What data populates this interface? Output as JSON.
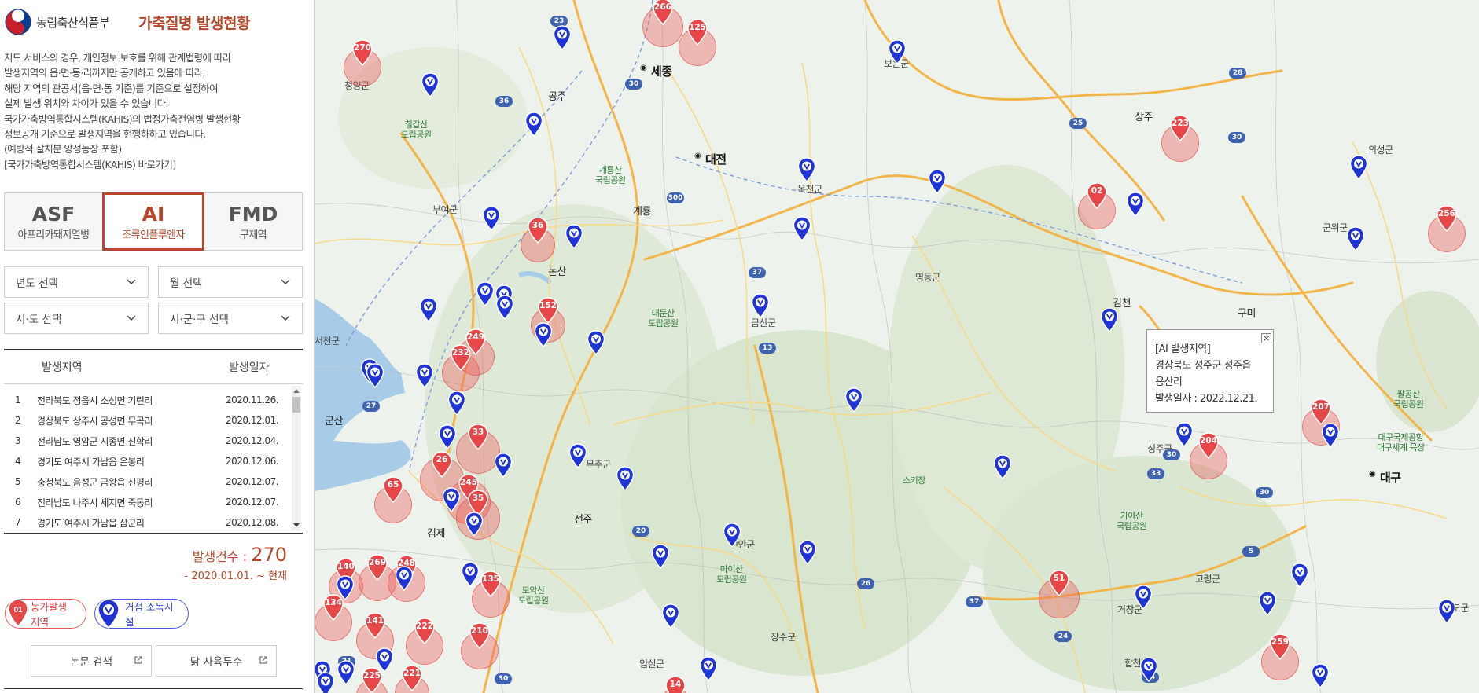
{
  "brand": {
    "ministry": "농림축산식품부",
    "title": "가축질병 발생현황"
  },
  "notice": {
    "lines": [
      "지도 서비스의 경우, 개인정보 보호를 위해 관계법령에 따라",
      "발생지역의 읍·면·동·리까지만 공개하고 있음에 따라,",
      "해당 지역의 관공서(읍·면·동 기준)를 기준으로 설정하여",
      "실제 발생 위치와 차이가 있을 수 있습니다.",
      "국가가축방역통합시스템(KAHIS)의 법정가축전염병 발생현황",
      "정보공개 기준으로 발생지역을 현행하하고 있습니다.",
      "(예방적 살처분 양성농장 포함)"
    ],
    "kahis_link": "[국가가축방역통합시스템(KAHIS) 바로가기]"
  },
  "disease_tabs": [
    {
      "code": "ASF",
      "name": "아프리카돼지열병",
      "active": false
    },
    {
      "code": "AI",
      "name": "조류인플루엔자",
      "active": true
    },
    {
      "code": "FMD",
      "name": "구제역",
      "active": false
    }
  ],
  "filters": {
    "year": "년도 선택",
    "month": "월 선택",
    "province": "시·도 선택",
    "city": "시·군·구 선택"
  },
  "table": {
    "headers": {
      "area": "발생지역",
      "date": "발생일자"
    },
    "rows": [
      {
        "no": "1",
        "area": "전라북도 정읍시 소성면 기린리",
        "date": "2020.11.26."
      },
      {
        "no": "2",
        "area": "경상북도 상주시 공성면 무곡리",
        "date": "2020.12.01."
      },
      {
        "no": "3",
        "area": "전라남도 영암군 시종면 신학리",
        "date": "2020.12.04."
      },
      {
        "no": "4",
        "area": "경기도 여주시 가남읍 은봉리",
        "date": "2020.12.06."
      },
      {
        "no": "5",
        "area": "충청북도 음성군 금왕읍 신평리",
        "date": "2020.12.07."
      },
      {
        "no": "6",
        "area": "전라남도 나주시 세지면 죽동리",
        "date": "2020.12.07."
      },
      {
        "no": "7",
        "area": "경기도 여주시 가남읍 삼군리",
        "date": "2020.12.08."
      }
    ]
  },
  "summary": {
    "count_label": "발생건수 : ",
    "count": "270",
    "period": "- 2020.01.01. ~ 현재"
  },
  "legend": {
    "farm_pin": "01",
    "farm": "농가발생지역",
    "disinfect": "거점 소독시설"
  },
  "links": {
    "papers": "논문 검색",
    "chicken": "닭 사육두수"
  },
  "map": {
    "places": [
      {
        "t": "세종",
        "k": "city"
      },
      {
        "t": "대전",
        "k": "city"
      },
      {
        "t": "대구",
        "k": "city"
      },
      {
        "t": "공주",
        "k": "mid"
      },
      {
        "t": "논산",
        "k": "mid"
      },
      {
        "t": "군산",
        "k": "mid"
      },
      {
        "t": "김제",
        "k": "mid"
      },
      {
        "t": "전주",
        "k": "mid"
      },
      {
        "t": "상주",
        "k": "mid"
      },
      {
        "t": "김천",
        "k": "mid"
      },
      {
        "t": "구미",
        "k": "mid"
      },
      {
        "t": "계룡",
        "k": "mid"
      },
      {
        "t": "청양군",
        "k": ""
      },
      {
        "t": "부여군",
        "k": ""
      },
      {
        "t": "서천군",
        "k": ""
      },
      {
        "t": "옥천군",
        "k": ""
      },
      {
        "t": "영동군",
        "k": ""
      },
      {
        "t": "금산군",
        "k": ""
      },
      {
        "t": "무주군",
        "k": ""
      },
      {
        "t": "장수군",
        "k": ""
      },
      {
        "t": "임실군",
        "k": ""
      },
      {
        "t": "고령군",
        "k": ""
      },
      {
        "t": "군위군",
        "k": ""
      },
      {
        "t": "의성군",
        "k": ""
      },
      {
        "t": "청도군",
        "k": ""
      },
      {
        "t": "합천군",
        "k": ""
      },
      {
        "t": "거창군",
        "k": ""
      },
      {
        "t": "성주군",
        "k": ""
      },
      {
        "t": "보은군",
        "k": ""
      },
      {
        "t": "진안군",
        "k": ""
      },
      {
        "t": "칠갑산\n도립공원",
        "k": "park"
      },
      {
        "t": "계룡산\n국립공원",
        "k": "park"
      },
      {
        "t": "대둔산\n도립공원",
        "k": "park"
      },
      {
        "t": "모악산\n도립공원",
        "k": "park"
      },
      {
        "t": "마이산\n도립공원",
        "k": "park"
      },
      {
        "t": "가야산\n국립공원",
        "k": "park"
      },
      {
        "t": "팔공산\n국립공원",
        "k": "park"
      },
      {
        "t": "스키장",
        "k": "park"
      },
      {
        "t": "대구국제공항\n대구세계 육상",
        "k": "park"
      }
    ],
    "shields": [
      "23",
      "36",
      "30",
      "300",
      "37",
      "13",
      "33",
      "25",
      "28",
      "30",
      "30",
      "20",
      "26",
      "37",
      "24",
      "30",
      "5",
      "24",
      "27",
      "30",
      "21"
    ],
    "red_pins": [
      "270",
      "266",
      "125",
      "36",
      "152",
      "249",
      "232",
      "33",
      "26",
      "245",
      "35",
      "65",
      "140",
      "269",
      "248",
      "134",
      "141",
      "135",
      "222",
      "210",
      "225",
      "221",
      "223",
      "02",
      "256",
      "207",
      "204",
      "51",
      "259",
      "14"
    ],
    "popup": {
      "title": "[AI 발생지역]",
      "address1": "경상북도 성주군 성주읍",
      "address2": "용산리",
      "date": "발생일자 : 2022.12.21.",
      "close": "×"
    }
  },
  "colors": {
    "accent": "#b6472c",
    "farm_red": "#e0393a",
    "disinfect_blue": "#2436d6"
  }
}
